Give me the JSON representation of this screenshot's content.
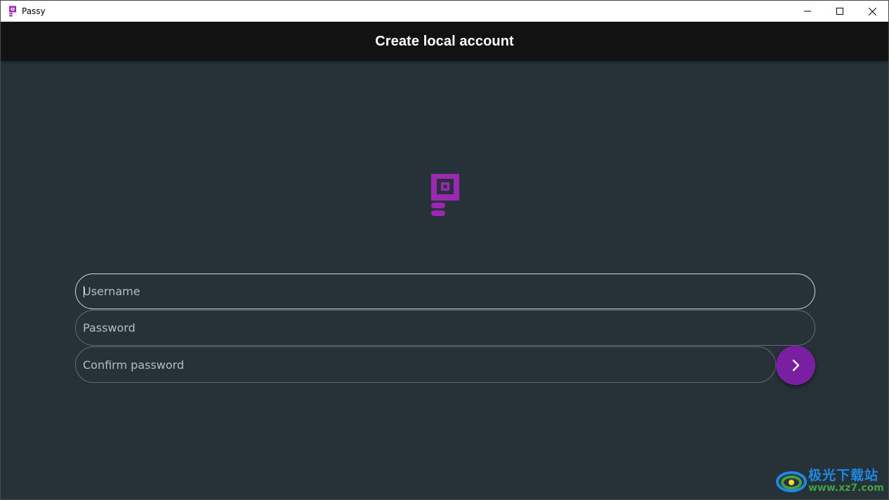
{
  "window": {
    "title": "Passy",
    "controls": {
      "minimize": "minimize-icon",
      "maximize": "maximize-icon",
      "close": "close-icon"
    }
  },
  "appbar": {
    "title": "Create local account"
  },
  "form": {
    "username_placeholder": "Username",
    "password_placeholder": "Password",
    "confirm_placeholder": "Confirm password",
    "submit_icon": "chevron-right-icon"
  },
  "watermark": {
    "cn": "极光下载站",
    "url": "www.xz7.com"
  },
  "colors": {
    "background": "#263238",
    "appbar": "#121212",
    "accent": "#7b1fa2",
    "logo": "#9c27b0"
  }
}
